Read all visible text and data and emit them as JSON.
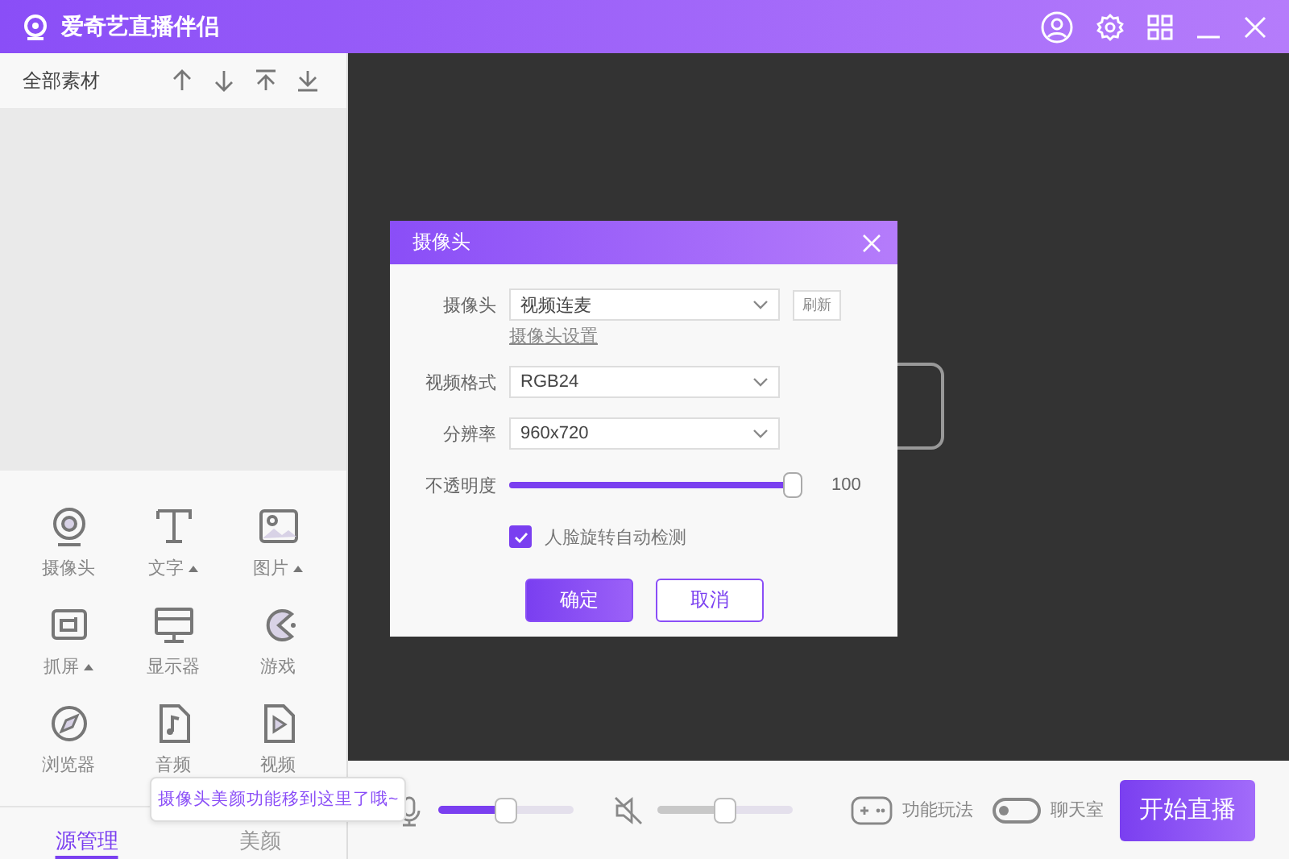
{
  "window": {
    "title": "爱奇艺直播伴侣"
  },
  "sources": {
    "title": "全部素材",
    "items": [
      {
        "label": "摄像头",
        "has_menu": false
      },
      {
        "label": "文字",
        "has_menu": true
      },
      {
        "label": "图片",
        "has_menu": true
      },
      {
        "label": "抓屏",
        "has_menu": true
      },
      {
        "label": "显示器",
        "has_menu": false
      },
      {
        "label": "游戏",
        "has_menu": false
      },
      {
        "label": "浏览器",
        "has_menu": false
      },
      {
        "label": "音频",
        "has_menu": false
      },
      {
        "label": "视频",
        "has_menu": false
      }
    ]
  },
  "tabs": [
    {
      "label": "源管理",
      "selected": true
    },
    {
      "label": "美颜",
      "selected": false
    }
  ],
  "tooltip": "摄像头美颜功能移到这里了哦~",
  "dialog": {
    "title": "摄像头",
    "fields": [
      {
        "kind": "select",
        "label": "摄像头",
        "value": "视频连麦",
        "button": "刷新",
        "link": "摄像头设置"
      },
      {
        "kind": "select",
        "label": "视频格式",
        "value": "RGB24"
      },
      {
        "kind": "select",
        "label": "分辨率",
        "value": "960x720"
      },
      {
        "kind": "slider",
        "label": "不透明度",
        "level": 1,
        "reading": "100"
      },
      {
        "kind": "checkbox",
        "label": "人脸旋转自动检测",
        "checked": true
      }
    ],
    "buttons": [
      {
        "label": "确定",
        "primary": true
      },
      {
        "label": "取消",
        "primary": false
      }
    ]
  },
  "audio": [
    {
      "kind": "mic",
      "muted": false,
      "level": 0.5
    },
    {
      "kind": "speaker",
      "muted": true,
      "level": 0.5
    }
  ],
  "features": [
    {
      "kind": "button",
      "label": "功能玩法"
    },
    {
      "kind": "toggle",
      "label": "聊天室",
      "on": false
    }
  ],
  "start_button": "开始直播"
}
